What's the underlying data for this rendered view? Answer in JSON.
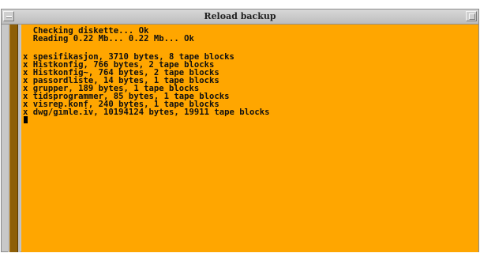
{
  "window": {
    "title": "Reload backup"
  },
  "terminal": {
    "background": "#ffa600",
    "text_color": "#101010",
    "lines": [
      "  Checking diskette... Ok",
      "  Reading 0.22 Mb... 0.22 Mb... Ok",
      "",
      "x spesifikasjon, 3710 bytes, 8 tape blocks",
      "x Histkonfig, 766 bytes, 2 tape blocks",
      "x Histkonfig~, 764 bytes, 2 tape blocks",
      "x passordliste, 14 bytes, 1 tape blocks",
      "x grupper, 189 bytes, 1 tape blocks",
      "x tidsprogrammer, 85 bytes, 1 tape blocks",
      "x visrep.konf, 240 bytes, 1 tape blocks",
      "x dwg/gimle.iv, 10194124 bytes, 19911 tape blocks"
    ]
  },
  "scrollbar": {
    "thumb_color": "#8e5f07"
  },
  "icons": {
    "window_menu": "window-menu-icon",
    "maximize": "maximize-icon"
  }
}
